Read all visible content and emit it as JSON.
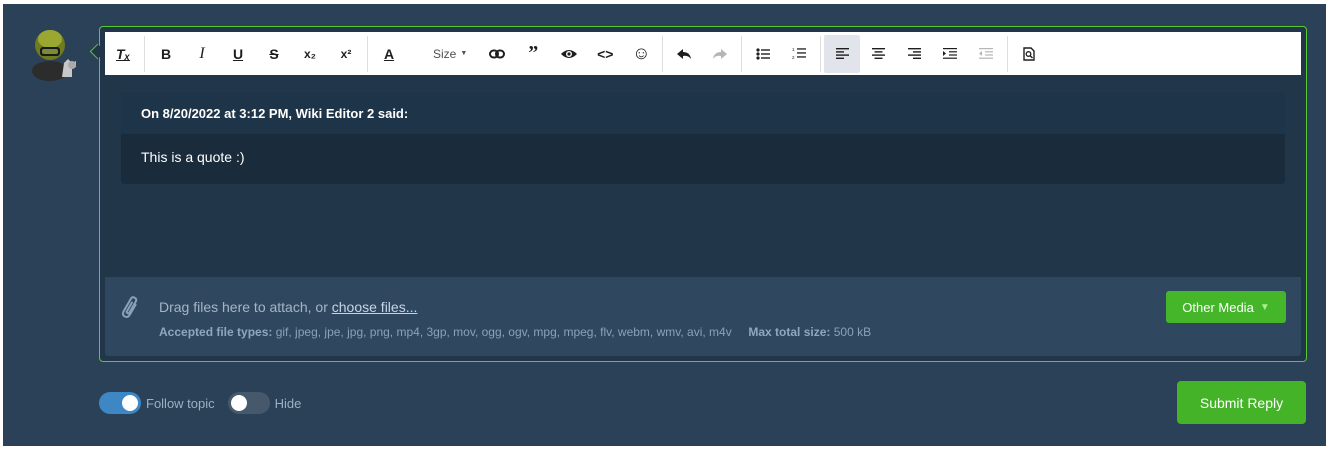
{
  "toolbar": {
    "buttons": [
      {
        "name": "clear-format-icon",
        "glyph": "Tₓ"
      },
      {
        "name": "bold-icon",
        "glyph": "B"
      },
      {
        "name": "italic-icon",
        "glyph": "I"
      },
      {
        "name": "underline-icon",
        "glyph": "U"
      },
      {
        "name": "strikethrough-icon",
        "glyph": "S"
      },
      {
        "name": "subscript-icon",
        "glyph": "x₂"
      },
      {
        "name": "superscript-icon",
        "glyph": "x²"
      },
      {
        "name": "text-color-icon",
        "glyph": "A"
      },
      {
        "name": "link-icon",
        "glyph": "⊖"
      },
      {
        "name": "quote-icon",
        "glyph": "❞"
      },
      {
        "name": "spoiler-eye-icon",
        "glyph": "◉"
      },
      {
        "name": "code-icon",
        "glyph": "<>"
      },
      {
        "name": "emoji-icon",
        "glyph": "☺"
      },
      {
        "name": "undo-icon",
        "glyph": "↶"
      },
      {
        "name": "redo-icon",
        "glyph": "↷"
      },
      {
        "name": "bullet-list-icon",
        "glyph": "☰"
      },
      {
        "name": "numbered-list-icon",
        "glyph": "☷"
      },
      {
        "name": "align-left-icon",
        "glyph": "≡"
      },
      {
        "name": "align-center-icon",
        "glyph": "≡"
      },
      {
        "name": "align-right-icon",
        "glyph": "≡"
      },
      {
        "name": "indent-icon",
        "glyph": "⇥"
      },
      {
        "name": "outdent-icon",
        "glyph": "⇤"
      },
      {
        "name": "preview-icon",
        "glyph": "⌕"
      }
    ],
    "size_label": "Size"
  },
  "quote": {
    "header": "On 8/20/2022 at 3:12 PM, Wiki Editor 2 said:",
    "body": "This is a quote :)"
  },
  "attach": {
    "drag_text": "Drag files here to attach, or ",
    "choose_link": "choose files...",
    "types_label": "Accepted file types:",
    "types_value": "gif, jpeg, jpe, jpg, png, mp4, 3gp, mov, ogg, ogv, mpg, mpeg, flv, webm, wmv, avi, m4v",
    "max_label": "Max total size:",
    "max_value": "500 kB",
    "other_media_label": "Other Media"
  },
  "options": {
    "follow_label": "Follow topic",
    "follow_on": true,
    "hide_label": "Hide",
    "hide_on": false
  },
  "submit_label": "Submit Reply",
  "colors": {
    "accent_green": "#45b52a",
    "toggle_blue": "#3d87c4",
    "page_bg": "#2a4158"
  }
}
